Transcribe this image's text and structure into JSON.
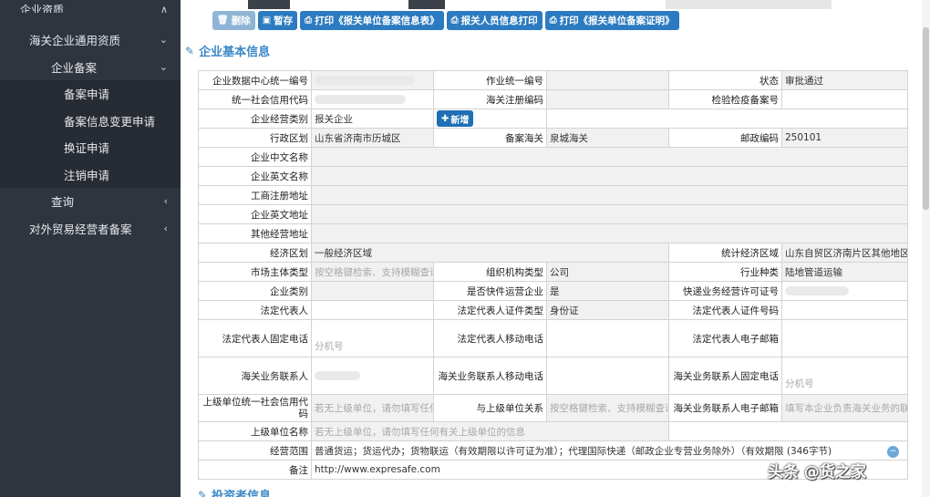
{
  "sidebar": {
    "top_item": "企业资质",
    "group1": "海关企业通用资质",
    "group1_sub": "企业备案",
    "items": [
      "备案申请",
      "备案信息变更申请",
      "换证申请",
      "注销申请"
    ],
    "query": "查询",
    "group2": "对外贸易经营者备案"
  },
  "toolbar": {
    "delete": "删除",
    "save": "暂存",
    "print_info": "打印《报关单位备案信息表》",
    "print_staff": "报关人员信息打印",
    "print_cert": "打印《报关单位备案证明》"
  },
  "section1": "企业基本信息",
  "section2": "投资者信息",
  "form": {
    "r1": {
      "l1": "企业数据中心统一编号",
      "l2": "作业统一编号",
      "l3": "状态",
      "v3": "审批通过"
    },
    "r2": {
      "l1": "统一社会信用代码",
      "l2": "海关注册编码",
      "l3": "检验检疫备案号"
    },
    "r3": {
      "l1": "企业经营类别",
      "v1": "报关企业",
      "add": "新增"
    },
    "r4": {
      "l1": "行政区划",
      "v1": "山东省济南市历城区",
      "l2": "备案海关",
      "v2": "泉城海关",
      "l3": "邮政编码",
      "v3": "250101"
    },
    "r5": {
      "l1": "企业中文名称"
    },
    "r6": {
      "l1": "企业英文名称"
    },
    "r7": {
      "l1": "工商注册地址"
    },
    "r8": {
      "l1": "企业英文地址"
    },
    "r9": {
      "l1": "其他经营地址"
    },
    "r10": {
      "l1": "经济区划",
      "v1": "一般经济区域",
      "l3": "统计经济区域",
      "v3": "山东自贸区济南片区其他地区"
    },
    "r11": {
      "l1": "市场主体类型",
      "p1": "按空格键检索、支持模糊查询",
      "l2": "组织机构类型",
      "v2": "公司",
      "l3": "行业种类",
      "v3": "陆地管道运输"
    },
    "r12": {
      "l1": "企业类别",
      "l2": "是否快件运营企业",
      "v2": "是",
      "l3": "快递业务经营许可证号"
    },
    "r13": {
      "l1": "法定代表人",
      "l2": "法定代表人证件类型",
      "v2": "身份证",
      "l3": "法定代表人证件号码"
    },
    "r14": {
      "l1": "法定代表人固定电话",
      "p1": "分机号",
      "l2": "法定代表人移动电话",
      "l3": "法定代表人电子邮箱"
    },
    "r15": {
      "l1": "海关业务联系人",
      "l2": "海关业务联系人移动电话",
      "l3": "海关业务联系人固定电话",
      "p3": "分机号"
    },
    "r16": {
      "l1": "上级单位统一社会信用代码",
      "p1": "若无上级单位，请勿填写任何",
      "l2": "与上级单位关系",
      "p2": "按空格键检索、支持模糊查询",
      "l3": "海关业务联系人电子邮箱",
      "p3": "填写本企业负责海关业务的联系人邮箱"
    },
    "r17": {
      "l1": "上级单位名称",
      "p1": "若无上级单位，请勿填写任何有关上级单位的信息"
    },
    "r18": {
      "l1": "经营范围",
      "v1": "普通货运；货运代办；货物联运（有效期限以许可证为准）；代理国际快递（邮政企业专营业务除外）（有效期限",
      "count": "(346字节)"
    },
    "r19": {
      "l1": "备注",
      "v1": "http://www.expresafe.com"
    }
  },
  "watermark": "头条 @货之家"
}
